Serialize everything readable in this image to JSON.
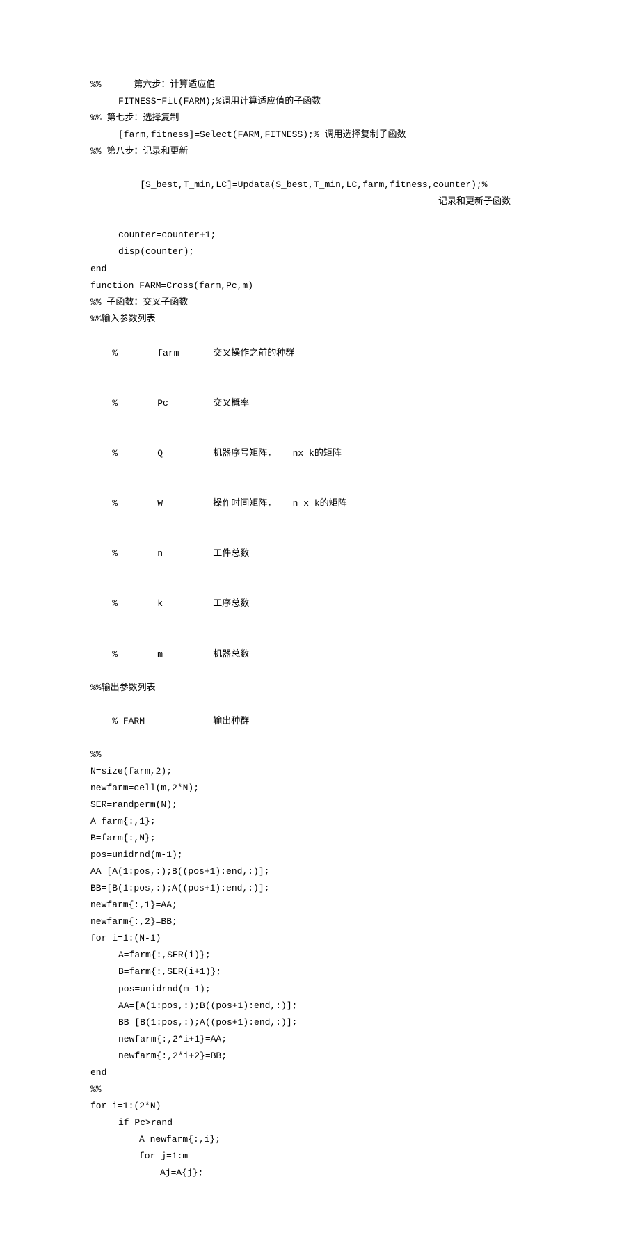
{
  "lines": {
    "l01": "%%      第六步：计算适应值",
    "l02": "FITNESS=Fit(FARM);%调用计算适应值的子函数",
    "l03": "%% 第七步：选择复制",
    "l04": "[farm,fitness]=Select(FARM,FITNESS);% 调用选择复制子函数",
    "l05": "%% 第八步：记录和更新",
    "l06a": "[S_best,T_min,LC]=Updata(S_best,T_min,LC,farm,fitness,counter);%",
    "l06b": "记录和更新子函数",
    "l07": "counter=counter+1;",
    "l08": "disp(counter);",
    "l09": "end",
    "l10": "function FARM=Cross(farm,Pc,m)",
    "l11": "%% 子函数：交叉子函数",
    "l12": "%%输入参数列表",
    "p1a": "%",
    "p1b": "farm",
    "p1c": "交叉操作之前的种群",
    "p2a": "%",
    "p2b": "Pc",
    "p2c": "交叉概率",
    "p3a": "%",
    "p3b": "Q",
    "p3c": "机器序号矩阵，   nx k的矩阵",
    "p4a": "%",
    "p4b": "W",
    "p4c": "操作时间矩阵，   n x k的矩阵",
    "p5a": "%",
    "p5b": "n",
    "p5c": "工件总数",
    "p6a": "%",
    "p6b": "k",
    "p6c": "工序总数",
    "p7a": "%",
    "p7b": "m",
    "p7c": "机器总数",
    "l13": "%%输出参数列表",
    "o1a": "% FARM",
    "o1c": "输出种群",
    "l14": "%%",
    "l15": "N=size(farm,2);",
    "l16": "newfarm=cell(m,2*N);",
    "l17": "SER=randperm(N);",
    "l18": "A=farm{:,1};",
    "l19": "B=farm{:,N};",
    "l20": "pos=unidrnd(m-1);",
    "l21": "AA=[A(1:pos,:);B((pos+1):end,:)];",
    "l22": "BB=[B(1:pos,:);A((pos+1):end,:)];",
    "l23": "newfarm{:,1}=AA;",
    "l24": "newfarm{:,2}=BB;",
    "l25": "for i=1:(N-1)",
    "l26": "A=farm{:,SER(i)};",
    "l27": "B=farm{:,SER(i+1)};",
    "l28": "pos=unidrnd(m-1);",
    "l29": "AA=[A(1:pos,:);B((pos+1):end,:)];",
    "l30": "BB=[B(1:pos,:);A((pos+1):end,:)];",
    "l31": "newfarm{:,2*i+1}=AA;",
    "l32": "newfarm{:,2*i+2}=BB;",
    "l33": "end",
    "l34": "%%",
    "l35": "for i=1:(2*N)",
    "l36": "if Pc>rand",
    "l37": "A=newfarm{:,i};",
    "l38": "for j=1:m",
    "l39": "Aj=A{j};"
  }
}
